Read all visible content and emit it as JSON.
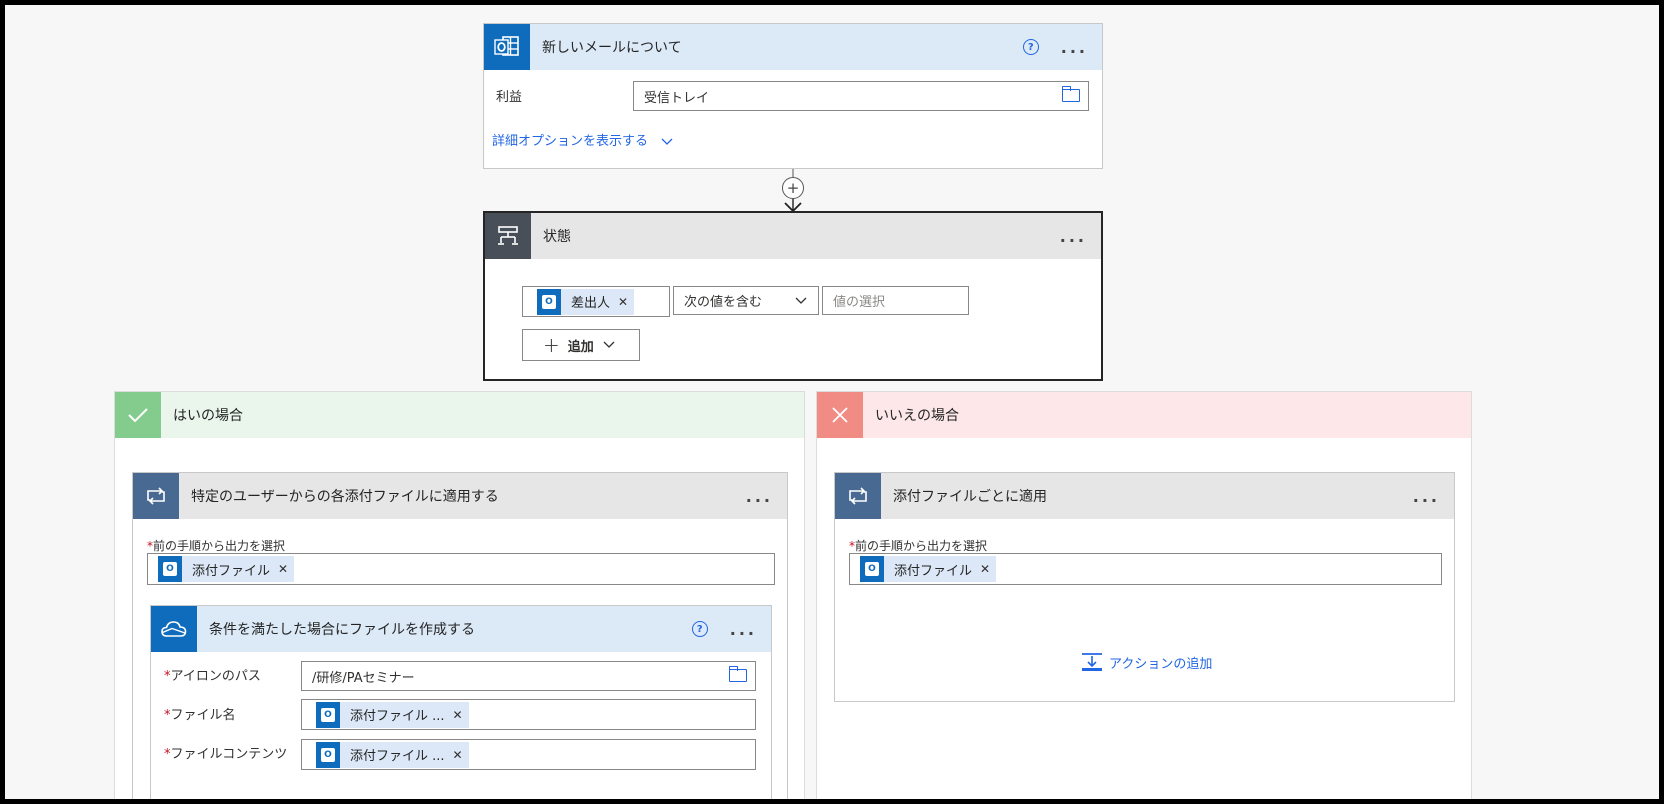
{
  "trigger": {
    "title": "新しいメールについて",
    "help": "?",
    "more": "...",
    "field_label": "利益",
    "field_value": "受信トレイ",
    "advanced_link": "詳細オプションを表示する"
  },
  "connector": {
    "plus": "+"
  },
  "condition": {
    "title": "状態",
    "more": "...",
    "left_token": "差出人",
    "operator": "次の値を含む",
    "value_placeholder": "値の選択",
    "add_label": "追加"
  },
  "yes_branch": {
    "title": "はいの場合",
    "foreach": {
      "title": "特定のユーザーからの各添付ファイルに適用する",
      "more": "...",
      "field_label": "前の手順から出力を選択",
      "token": "添付ファイル"
    },
    "create_file": {
      "title": "条件を満たした場合にファイルを作成する",
      "help": "?",
      "more": "...",
      "folder_label": "アイロンのパス",
      "folder_value": "/研修/PAセミナー",
      "filename_label": "ファイル名",
      "filename_token": "添付ファイル ...",
      "content_label": "ファイルコンテンツ",
      "content_token": "添付ファイル ..."
    }
  },
  "no_branch": {
    "title": "いいえの場合",
    "foreach": {
      "title": "添付ファイルごとに適用",
      "more": "...",
      "field_label": "前の手順から出力を選択",
      "token": "添付ファイル"
    },
    "add_action": "アクションの追加"
  },
  "colors": {
    "trigger_header": "#dce9f7",
    "outlook_blue": "#0f6cbd",
    "condition_header": "#e6e6e6",
    "condition_icon": "#484f58",
    "yes_green": "#84cc8e",
    "yes_header": "#eaf6ec",
    "no_red": "#f08c84",
    "no_header": "#fde7e9",
    "loop_icon": "#486991",
    "link_blue": "#2266e3"
  }
}
